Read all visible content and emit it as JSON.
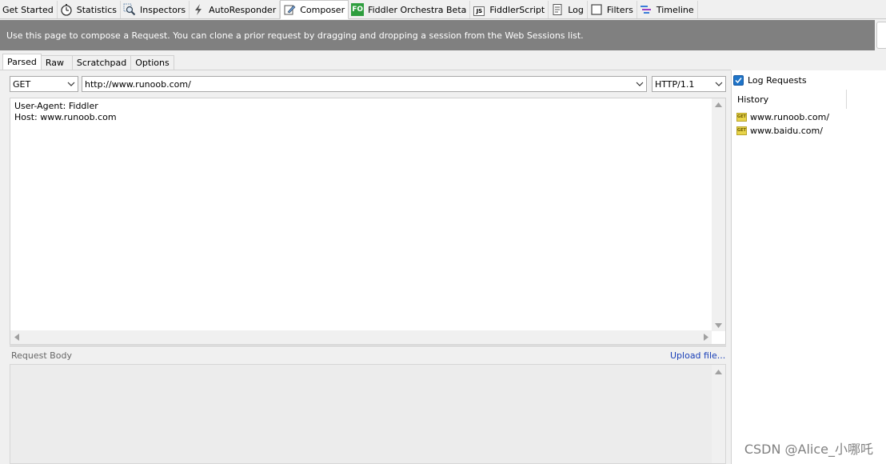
{
  "tabs": [
    {
      "label": "Get Started",
      "icon": "none"
    },
    {
      "label": "Statistics",
      "icon": "stopwatch-icon"
    },
    {
      "label": "Inspectors",
      "icon": "magnifier-icon"
    },
    {
      "label": "AutoResponder",
      "icon": "lightning-icon"
    },
    {
      "label": "Composer",
      "icon": "pencil-icon"
    },
    {
      "label": "Fiddler Orchestra Beta",
      "icon": "fo-badge-icon",
      "badge": "FO"
    },
    {
      "label": "FiddlerScript",
      "icon": "js-file-icon",
      "badge": "JS"
    },
    {
      "label": "Log",
      "icon": "document-icon"
    },
    {
      "label": "Filters",
      "icon": "checkbox-icon"
    },
    {
      "label": "Timeline",
      "icon": "timeline-icon"
    }
  ],
  "active_tab": "Composer",
  "info_text": "Use this page to compose a Request. You can clone a prior request by dragging and dropping a session from the Web Sessions list.",
  "subtabs": [
    "Parsed",
    "Raw",
    "Scratchpad",
    "Options"
  ],
  "active_subtab": "Parsed",
  "request": {
    "method": "GET",
    "url": "http://www.runoob.com/",
    "version": "HTTP/1.1"
  },
  "headers_text": "User-Agent: Fiddler\nHost: www.runoob.com",
  "body_label": "Request Body",
  "upload_label": "Upload file...",
  "log_requests": {
    "label": "Log Requests",
    "checked": true
  },
  "history": {
    "header": "History",
    "badge": "GET",
    "items": [
      "www.runoob.com/",
      "www.baidu.com/"
    ]
  },
  "watermark": "CSDN @Alice_小哪吒",
  "colors": {
    "info_bar": "#808080",
    "fo_badge": "#2e9e3e",
    "checkbox": "#1e74c8",
    "link": "#1a40b8",
    "get_badge": "#e8d44a"
  }
}
